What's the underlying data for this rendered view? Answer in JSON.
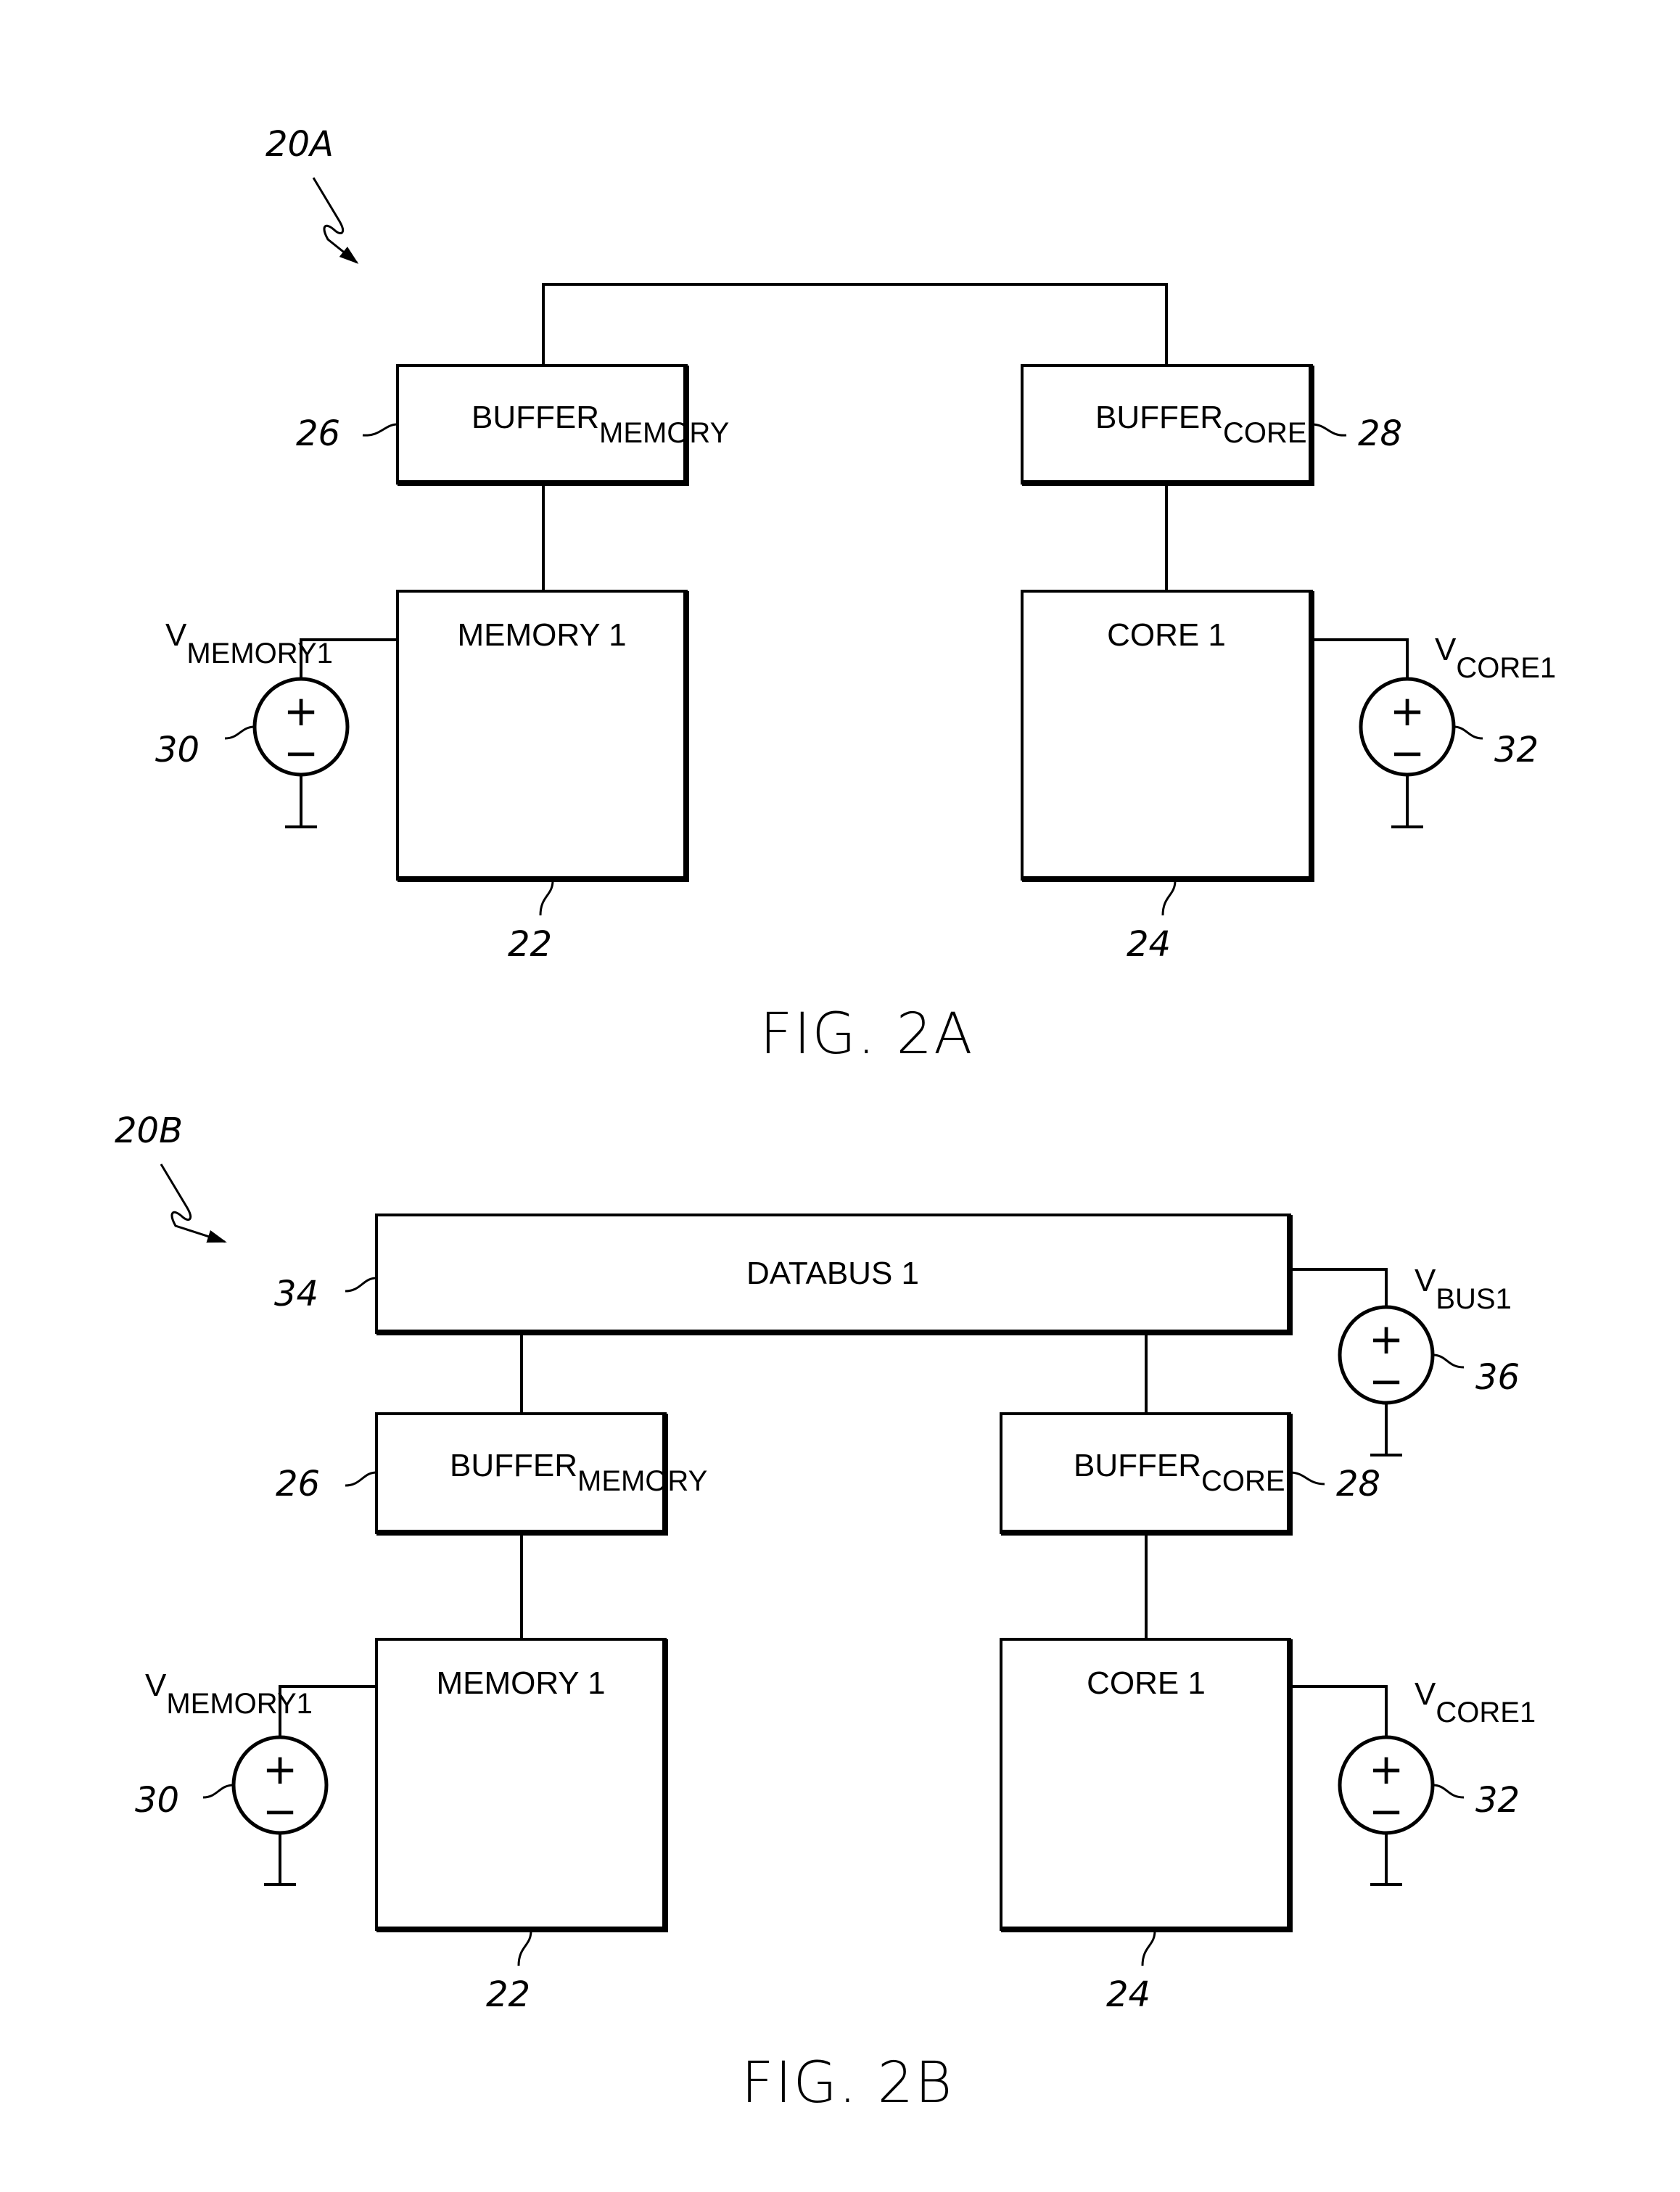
{
  "figures": [
    {
      "id": "fig2a",
      "caption": "FIG. 2A",
      "ref_label": "20A",
      "blocks": {
        "buffer_memory": {
          "main": "BUFFER",
          "sub": "MEMORY",
          "ref": "26"
        },
        "buffer_core": {
          "main": "BUFFER",
          "sub": "CORE",
          "ref": "28"
        },
        "memory": {
          "label": "MEMORY 1",
          "ref": "22"
        },
        "core": {
          "label": "CORE 1",
          "ref": "24"
        }
      },
      "sources": {
        "memory": {
          "main": "V",
          "sub": "MEMORY1",
          "ref": "30",
          "plus": "+",
          "minus": "−"
        },
        "core": {
          "main": "V",
          "sub": "CORE1",
          "ref": "32",
          "plus": "+",
          "minus": "−"
        }
      }
    },
    {
      "id": "fig2b",
      "caption": "FIG. 2B",
      "ref_label": "20B",
      "blocks": {
        "databus": {
          "label": "DATABUS 1",
          "ref": "34"
        },
        "buffer_memory": {
          "main": "BUFFER",
          "sub": "MEMORY",
          "ref": "26"
        },
        "buffer_core": {
          "main": "BUFFER",
          "sub": "CORE",
          "ref": "28"
        },
        "memory": {
          "label": "MEMORY 1",
          "ref": "22"
        },
        "core": {
          "label": "CORE 1",
          "ref": "24"
        }
      },
      "sources": {
        "bus": {
          "main": "V",
          "sub": "BUS1",
          "ref": "36",
          "plus": "+",
          "minus": "−"
        },
        "memory": {
          "main": "V",
          "sub": "MEMORY1",
          "ref": "30",
          "plus": "+",
          "minus": "−"
        },
        "core": {
          "main": "V",
          "sub": "CORE1",
          "ref": "32",
          "plus": "+",
          "minus": "−"
        }
      }
    }
  ]
}
